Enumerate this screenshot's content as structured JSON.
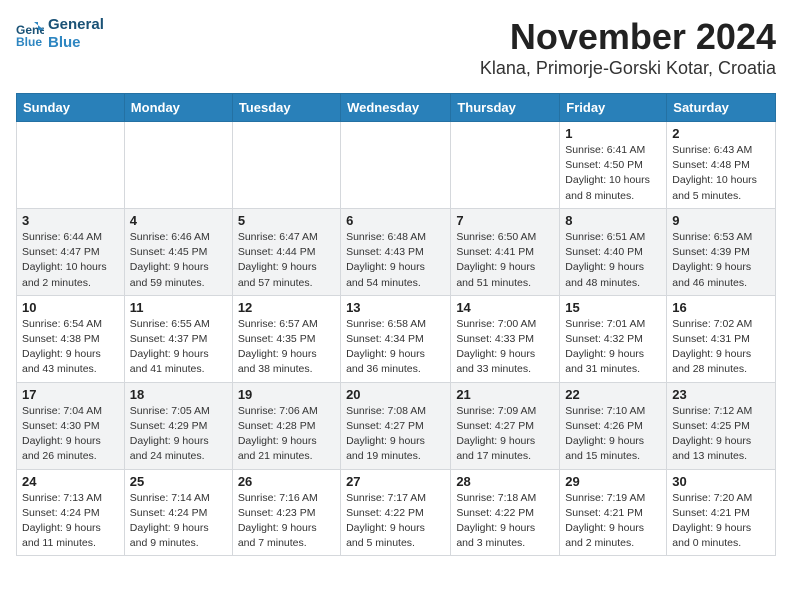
{
  "app": {
    "logo_line1": "General",
    "logo_line2": "Blue"
  },
  "title": "November 2024",
  "location": "Klana, Primorje-Gorski Kotar, Croatia",
  "weekdays": [
    "Sunday",
    "Monday",
    "Tuesday",
    "Wednesday",
    "Thursday",
    "Friday",
    "Saturday"
  ],
  "weeks": [
    [
      {
        "day": "",
        "info": ""
      },
      {
        "day": "",
        "info": ""
      },
      {
        "day": "",
        "info": ""
      },
      {
        "day": "",
        "info": ""
      },
      {
        "day": "",
        "info": ""
      },
      {
        "day": "1",
        "info": "Sunrise: 6:41 AM\nSunset: 4:50 PM\nDaylight: 10 hours\nand 8 minutes."
      },
      {
        "day": "2",
        "info": "Sunrise: 6:43 AM\nSunset: 4:48 PM\nDaylight: 10 hours\nand 5 minutes."
      }
    ],
    [
      {
        "day": "3",
        "info": "Sunrise: 6:44 AM\nSunset: 4:47 PM\nDaylight: 10 hours\nand 2 minutes."
      },
      {
        "day": "4",
        "info": "Sunrise: 6:46 AM\nSunset: 4:45 PM\nDaylight: 9 hours\nand 59 minutes."
      },
      {
        "day": "5",
        "info": "Sunrise: 6:47 AM\nSunset: 4:44 PM\nDaylight: 9 hours\nand 57 minutes."
      },
      {
        "day": "6",
        "info": "Sunrise: 6:48 AM\nSunset: 4:43 PM\nDaylight: 9 hours\nand 54 minutes."
      },
      {
        "day": "7",
        "info": "Sunrise: 6:50 AM\nSunset: 4:41 PM\nDaylight: 9 hours\nand 51 minutes."
      },
      {
        "day": "8",
        "info": "Sunrise: 6:51 AM\nSunset: 4:40 PM\nDaylight: 9 hours\nand 48 minutes."
      },
      {
        "day": "9",
        "info": "Sunrise: 6:53 AM\nSunset: 4:39 PM\nDaylight: 9 hours\nand 46 minutes."
      }
    ],
    [
      {
        "day": "10",
        "info": "Sunrise: 6:54 AM\nSunset: 4:38 PM\nDaylight: 9 hours\nand 43 minutes."
      },
      {
        "day": "11",
        "info": "Sunrise: 6:55 AM\nSunset: 4:37 PM\nDaylight: 9 hours\nand 41 minutes."
      },
      {
        "day": "12",
        "info": "Sunrise: 6:57 AM\nSunset: 4:35 PM\nDaylight: 9 hours\nand 38 minutes."
      },
      {
        "day": "13",
        "info": "Sunrise: 6:58 AM\nSunset: 4:34 PM\nDaylight: 9 hours\nand 36 minutes."
      },
      {
        "day": "14",
        "info": "Sunrise: 7:00 AM\nSunset: 4:33 PM\nDaylight: 9 hours\nand 33 minutes."
      },
      {
        "day": "15",
        "info": "Sunrise: 7:01 AM\nSunset: 4:32 PM\nDaylight: 9 hours\nand 31 minutes."
      },
      {
        "day": "16",
        "info": "Sunrise: 7:02 AM\nSunset: 4:31 PM\nDaylight: 9 hours\nand 28 minutes."
      }
    ],
    [
      {
        "day": "17",
        "info": "Sunrise: 7:04 AM\nSunset: 4:30 PM\nDaylight: 9 hours\nand 26 minutes."
      },
      {
        "day": "18",
        "info": "Sunrise: 7:05 AM\nSunset: 4:29 PM\nDaylight: 9 hours\nand 24 minutes."
      },
      {
        "day": "19",
        "info": "Sunrise: 7:06 AM\nSunset: 4:28 PM\nDaylight: 9 hours\nand 21 minutes."
      },
      {
        "day": "20",
        "info": "Sunrise: 7:08 AM\nSunset: 4:27 PM\nDaylight: 9 hours\nand 19 minutes."
      },
      {
        "day": "21",
        "info": "Sunrise: 7:09 AM\nSunset: 4:27 PM\nDaylight: 9 hours\nand 17 minutes."
      },
      {
        "day": "22",
        "info": "Sunrise: 7:10 AM\nSunset: 4:26 PM\nDaylight: 9 hours\nand 15 minutes."
      },
      {
        "day": "23",
        "info": "Sunrise: 7:12 AM\nSunset: 4:25 PM\nDaylight: 9 hours\nand 13 minutes."
      }
    ],
    [
      {
        "day": "24",
        "info": "Sunrise: 7:13 AM\nSunset: 4:24 PM\nDaylight: 9 hours\nand 11 minutes."
      },
      {
        "day": "25",
        "info": "Sunrise: 7:14 AM\nSunset: 4:24 PM\nDaylight: 9 hours\nand 9 minutes."
      },
      {
        "day": "26",
        "info": "Sunrise: 7:16 AM\nSunset: 4:23 PM\nDaylight: 9 hours\nand 7 minutes."
      },
      {
        "day": "27",
        "info": "Sunrise: 7:17 AM\nSunset: 4:22 PM\nDaylight: 9 hours\nand 5 minutes."
      },
      {
        "day": "28",
        "info": "Sunrise: 7:18 AM\nSunset: 4:22 PM\nDaylight: 9 hours\nand 3 minutes."
      },
      {
        "day": "29",
        "info": "Sunrise: 7:19 AM\nSunset: 4:21 PM\nDaylight: 9 hours\nand 2 minutes."
      },
      {
        "day": "30",
        "info": "Sunrise: 7:20 AM\nSunset: 4:21 PM\nDaylight: 9 hours\nand 0 minutes."
      }
    ]
  ]
}
